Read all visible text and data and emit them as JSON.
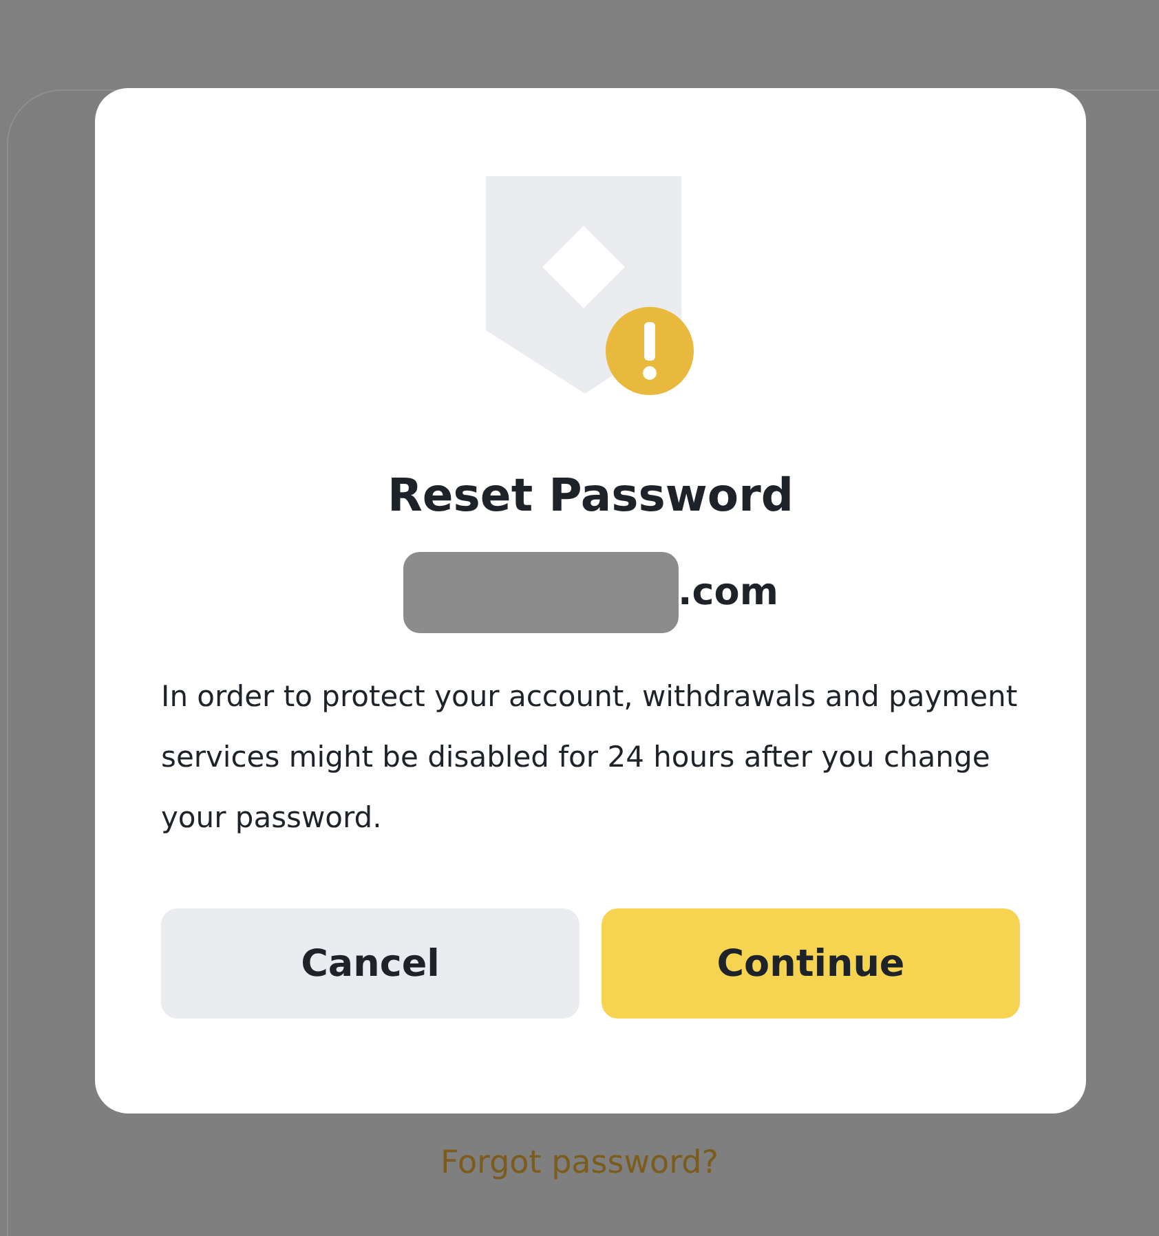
{
  "background": {
    "forgot_link": "Forgot password?"
  },
  "dialog": {
    "title": "Reset Password",
    "email_suffix": ".com",
    "message": "In order to protect your account, withdrawals and payment services might be disabled for 24 hours after you change your password.",
    "buttons": [
      {
        "label": "Cancel",
        "kind": "secondary"
      },
      {
        "label": "Continue",
        "kind": "primary"
      }
    ]
  }
}
